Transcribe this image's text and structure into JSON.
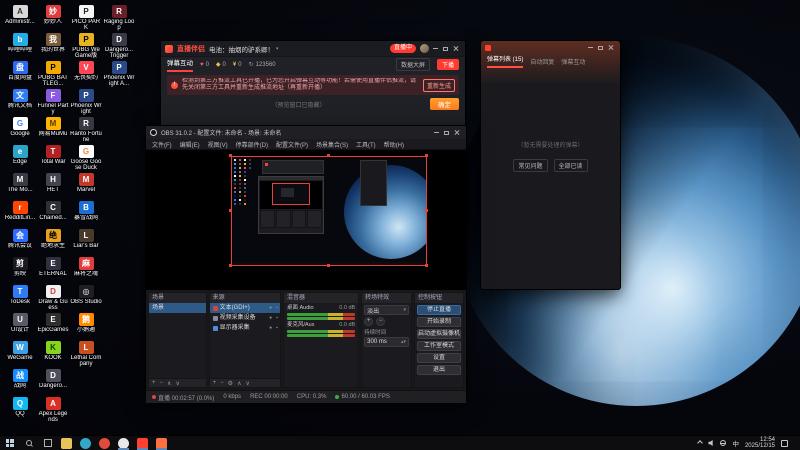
{
  "desktop": {
    "columns": [
      [
        {
          "label": "Administr...",
          "c": "#d8d8d8",
          "fg": "#333",
          "g": "A"
        },
        {
          "label": "哔哩哔哩",
          "c": "#23ade5",
          "g": "b"
        },
        {
          "label": "百度网盘",
          "c": "#2a6bf2",
          "g": "盘"
        },
        {
          "label": "腾讯文档",
          "c": "#2f7cf6",
          "g": "文"
        },
        {
          "label": "Google",
          "c": "#ffffff",
          "fg": "#4285f4",
          "g": "G"
        },
        {
          "label": "Edge",
          "c": "#2ba4c8",
          "g": "e"
        },
        {
          "label": "The Mo...",
          "c": "#3a3a44",
          "g": "M"
        },
        {
          "label": "RedditLin...",
          "c": "#ff4500",
          "g": "r"
        },
        {
          "label": "腾讯会议",
          "c": "#2b6bff",
          "g": "会"
        },
        {
          "label": "剪映",
          "c": "#1b1b1f",
          "g": "剪"
        },
        {
          "label": "ToDesk",
          "c": "#2f7bf5",
          "g": "T"
        },
        {
          "label": "UI设计",
          "c": "#5a5a66",
          "g": "U"
        },
        {
          "label": "WeGame",
          "c": "#3aa0e8",
          "g": "W"
        },
        {
          "label": "战网",
          "c": "#148eff",
          "g": "战"
        },
        {
          "label": "QQ",
          "c": "#12b7f5",
          "g": "Q"
        }
      ],
      [
        {
          "label": "妙妙人",
          "c": "#e23c3c",
          "g": "妙"
        },
        {
          "label": "我的世界",
          "c": "#7a5a3a",
          "g": "我"
        },
        {
          "label": "PUBG BATTLEG...",
          "c": "#f2a900",
          "fg": "#000",
          "g": "P"
        },
        {
          "label": "Funnel Party",
          "c": "#8a5ae2",
          "g": "F"
        },
        {
          "label": "网易MuMu",
          "c": "#ffb400",
          "fg": "#5a3a00",
          "g": "M"
        },
        {
          "label": "Total War",
          "c": "#b22222",
          "g": "T"
        },
        {
          "label": "HET",
          "c": "#444450",
          "g": "H"
        },
        {
          "label": "Chained...",
          "c": "#2f2f38",
          "g": "C"
        },
        {
          "label": "绝地求生",
          "c": "#e8a020",
          "fg": "#000",
          "g": "绝"
        },
        {
          "label": "ETERNAL",
          "c": "#303040",
          "g": "E"
        },
        {
          "label": "Draw & Guess",
          "c": "#f0f0f0",
          "fg": "#d04040",
          "g": "D"
        },
        {
          "label": "EpicGames",
          "c": "#2f2f2f",
          "g": "E"
        },
        {
          "label": "KOOK",
          "c": "#85d51c",
          "fg": "#1a3a00",
          "g": "K"
        },
        {
          "label": "Dangero...",
          "c": "#50505c",
          "g": "D"
        },
        {
          "label": "Apex Legends",
          "c": "#d93025",
          "g": "A"
        }
      ],
      [
        {
          "label": "PICO PARK",
          "c": "#f5f5f5",
          "fg": "#222",
          "g": "P"
        },
        {
          "label": "PUBG WeGame版",
          "c": "#e8b220",
          "fg": "#000",
          "g": "P"
        },
        {
          "label": "无畏契约",
          "c": "#ff4655",
          "g": "V"
        },
        {
          "label": "Phoenix Wright",
          "c": "#2a4a8a",
          "g": "P"
        },
        {
          "label": "Ranto Fortune",
          "c": "#383842",
          "g": "R"
        },
        {
          "label": "Goose Goose Duck",
          "c": "#ffffff",
          "fg": "#e88a40",
          "g": "G"
        },
        {
          "label": "Marvel",
          "c": "#c0392b",
          "g": "M"
        },
        {
          "label": "暴雪战网",
          "c": "#1a6fd4",
          "g": "B"
        },
        {
          "label": "Liar's Bar",
          "c": "#4a3a2a",
          "g": "L"
        },
        {
          "label": "麻将之魂",
          "c": "#e23c3c",
          "g": "麻"
        },
        {
          "label": "OBS Studio",
          "c": "#1f1f23",
          "g": "◎"
        },
        {
          "label": "小鹅通",
          "c": "#ff8a00",
          "g": "鹅"
        },
        {
          "label": "Lethal Company",
          "c": "#c8501e",
          "g": "L"
        }
      ],
      [
        {
          "label": "Raging Loop",
          "c": "#6a1f2a",
          "g": "R"
        },
        {
          "label": "Dangero... Trigger",
          "c": "#3a3a46",
          "g": "D"
        },
        {
          "label": "Phoenix Wright A...",
          "c": "#2a4a8a",
          "g": "P"
        }
      ]
    ]
  },
  "companion": {
    "logo_text": "直播伴侣",
    "room_title": "电池：抽烟的驴系卿！",
    "live_badge": "直播中",
    "tab": "弹幕互动",
    "stats": [
      {
        "name": "likes",
        "icon": "♥",
        "color": "#ff5a6a",
        "value": "0"
      },
      {
        "name": "viewers",
        "icon": "◆",
        "color": "#e8b84a",
        "value": "0"
      },
      {
        "name": "gifts",
        "icon": "¥",
        "color": "#ffd04a",
        "value": "0"
      },
      {
        "name": "refresh",
        "icon": "↻",
        "color": "#8aa0c8",
        "value": "123560"
      }
    ],
    "actions": [
      "数据大屏",
      "下播"
    ],
    "banner": {
      "text": "检测到第三方推流工具已开播，已为您开启弹幕互动等功能！若需使用直播伴侣推流，请先关闭第三方工具并重新生成推流地址（再重新开播）",
      "button": "重新生成"
    },
    "confirm_button": "确定",
    "footer_note": "（预览窗口已隐藏）"
  },
  "chat": {
    "tabs": [
      {
        "label": "弹幕列表 (15)",
        "active": true
      },
      {
        "label": "自动回复",
        "active": false
      },
      {
        "label": "弹幕互动",
        "active": false
      }
    ],
    "empty_text": "（暂无需要处理的弹幕）",
    "buttons": [
      "常见问题",
      "全部已读"
    ]
  },
  "obs": {
    "title": "OBS 31.0.2 - 配置文件: 未命名 - 场景: 未命名",
    "menu": [
      "文件(F)",
      "编辑(E)",
      "视图(V)",
      "停靠部件(D)",
      "配置文件(P)",
      "场景集合(S)",
      "工具(T)",
      "帮助(H)"
    ],
    "scenes": {
      "title": "场景",
      "items": [
        {
          "label": "场景",
          "selected": true
        }
      ]
    },
    "sources": {
      "title": "来源",
      "items": [
        {
          "label": "文本(GDI+)",
          "c": "#d04545",
          "selected": true
        },
        {
          "label": "视频采集设备",
          "c": "#8888a0",
          "selected": false
        },
        {
          "label": "显示器采集",
          "c": "#4a90d9",
          "selected": false
        }
      ]
    },
    "mixer": {
      "title": "混音器",
      "channels": [
        {
          "name": "桌面 Audio",
          "db": "0.0 dB"
        },
        {
          "name": "麦克风/Aux",
          "db": "0.0 dB"
        }
      ]
    },
    "transitions": {
      "title": "转场特效",
      "selected": "淡出",
      "duration_label": "持续时间",
      "duration": "300 ms"
    },
    "controls": {
      "title": "控制按钮",
      "buttons": [
        {
          "label": "停止直播",
          "active": true
        },
        {
          "label": "开始录制",
          "active": false
        },
        {
          "label": "启动虚拟摄像机",
          "active": false
        },
        {
          "label": "工作室模式",
          "active": false
        },
        {
          "label": "设置",
          "active": false
        },
        {
          "label": "退出",
          "active": false
        }
      ]
    },
    "status": [
      "直播 00:02:57 (0.0%)",
      "0 kbps",
      "REC 00:00:00",
      "CPU: 0.3%",
      "60.00 / 60.03 FPS"
    ]
  },
  "taskbar": {
    "apps": [
      {
        "name": "explorer",
        "c": "#e8c35a",
        "active": false
      },
      {
        "name": "edge",
        "c": "#35a6c6",
        "active": false
      },
      {
        "name": "chrome",
        "c": "#e04c3c",
        "active": false
      },
      {
        "name": "obs",
        "c": "#e8e8ea",
        "active": true
      },
      {
        "name": "live-companion",
        "c": "#ff4030",
        "active": true
      },
      {
        "name": "chat-helper",
        "c": "#ff7040",
        "active": true
      }
    ],
    "lang": "中",
    "time": "12:54",
    "date": "2025/12/15"
  }
}
